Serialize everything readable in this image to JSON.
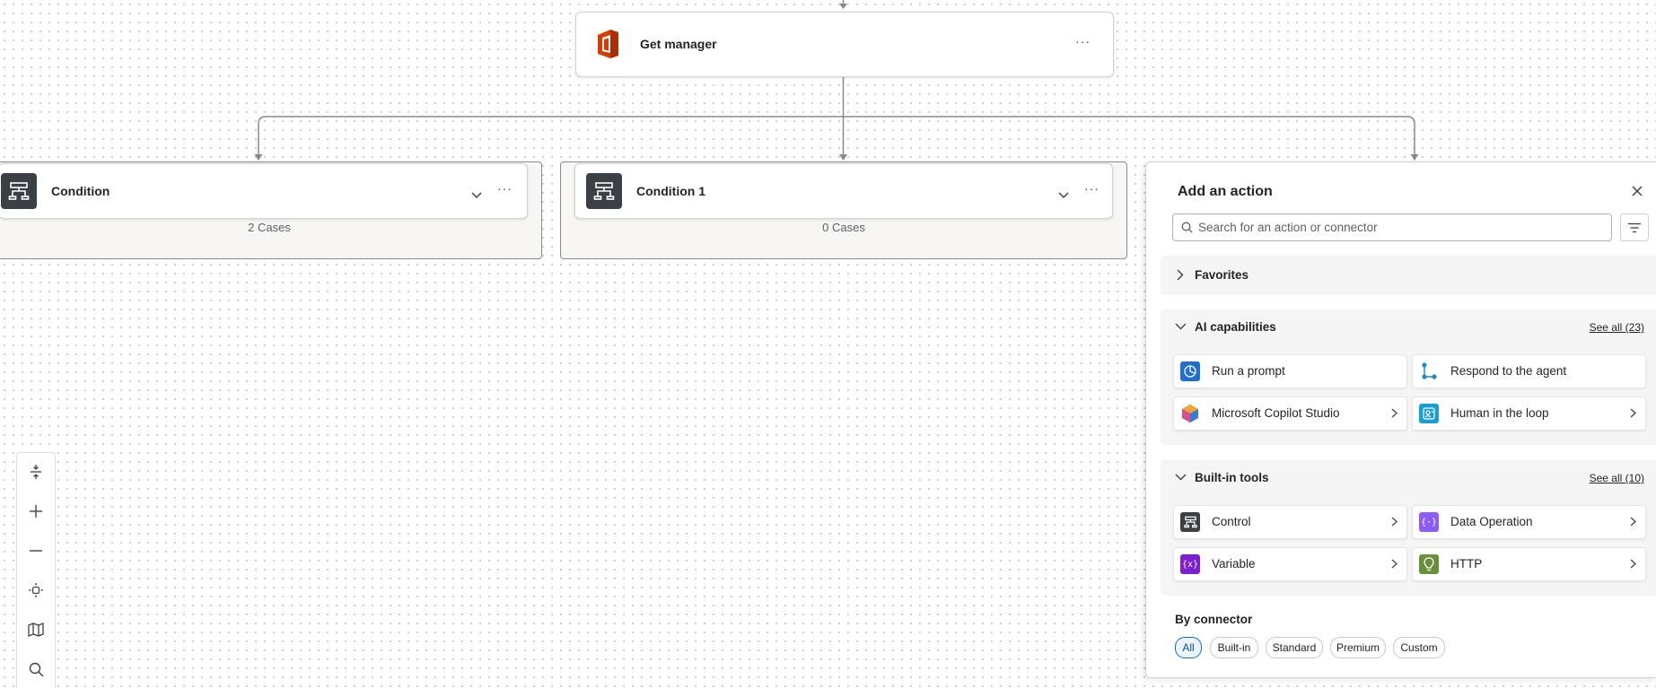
{
  "canvas": {
    "get_manager": {
      "title": "Get manager",
      "more": "···"
    },
    "condition": {
      "title": "Condition",
      "cases": "2 Cases",
      "more": "···"
    },
    "condition1": {
      "title": "Condition 1",
      "cases": "0 Cases",
      "more": "···"
    }
  },
  "zoom_controls": [
    "fit-height-icon",
    "zoom-in-icon",
    "zoom-out-icon",
    "fit-view-icon",
    "minimap-icon",
    "search-icon"
  ],
  "panel": {
    "title": "Add an action",
    "search_placeholder": "Search for an action or connector",
    "favorites": {
      "label": "Favorites"
    },
    "ai": {
      "label": "AI capabilities",
      "see_all": "See all (23)",
      "items": [
        {
          "label": "Run a prompt",
          "icon": "prompt-icon",
          "color": "#1f6fd1"
        },
        {
          "label": "Respond to the agent",
          "icon": "agent-respond-icon",
          "color": "#1e88c9"
        },
        {
          "label": "Microsoft Copilot Studio",
          "icon": "copilot-studio-icon",
          "color": "#2bb673"
        },
        {
          "label": "Human in the loop",
          "icon": "human-loop-icon",
          "color": "#1b9bd8"
        }
      ]
    },
    "builtin": {
      "label": "Built-in tools",
      "see_all": "See all (10)",
      "items": [
        {
          "label": "Control",
          "icon": "control-icon",
          "color": "#3b3f46"
        },
        {
          "label": "Data Operation",
          "icon": "data-operation-icon",
          "color": "#8b5cf6"
        },
        {
          "label": "Variable",
          "icon": "variable-icon",
          "color": "#7b1fd1"
        },
        {
          "label": "HTTP",
          "icon": "http-icon",
          "color": "#6a8f3a"
        }
      ]
    },
    "by_connector": {
      "label": "By connector",
      "filters": [
        "All",
        "Built-in",
        "Standard",
        "Premium",
        "Custom"
      ],
      "selected": "All"
    }
  }
}
